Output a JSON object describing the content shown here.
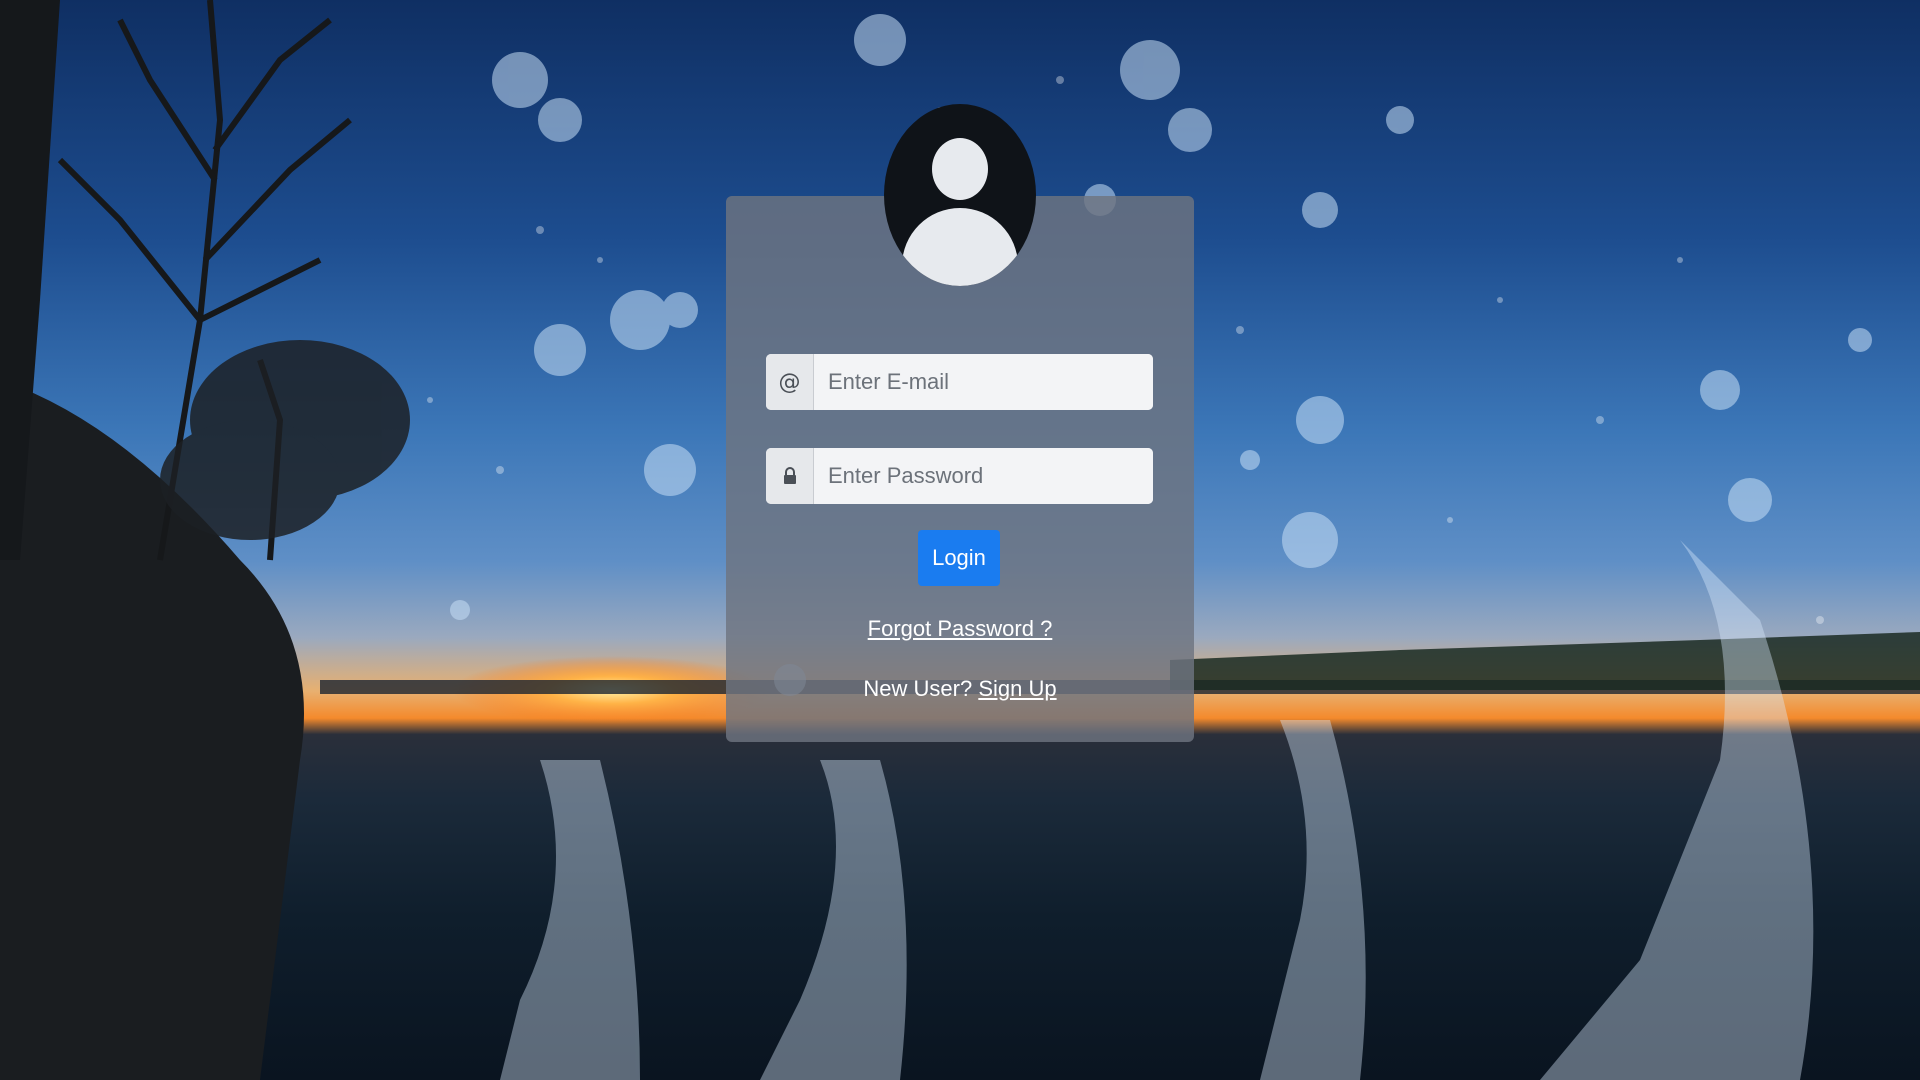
{
  "login": {
    "email_placeholder": "Enter E-mail",
    "email_addon": "@",
    "password_placeholder": "Enter Password",
    "password_icon": "lock-icon",
    "login_label": "Login",
    "forgot_label": "Forgot Password ?",
    "new_user_text": "New User?",
    "signup_label": "Sign Up"
  },
  "avatar": {
    "icon": "user-avatar-icon"
  },
  "colors": {
    "button": "#1a7cf0",
    "card": "#6e7480",
    "avatar_bg": "#0f1318"
  }
}
